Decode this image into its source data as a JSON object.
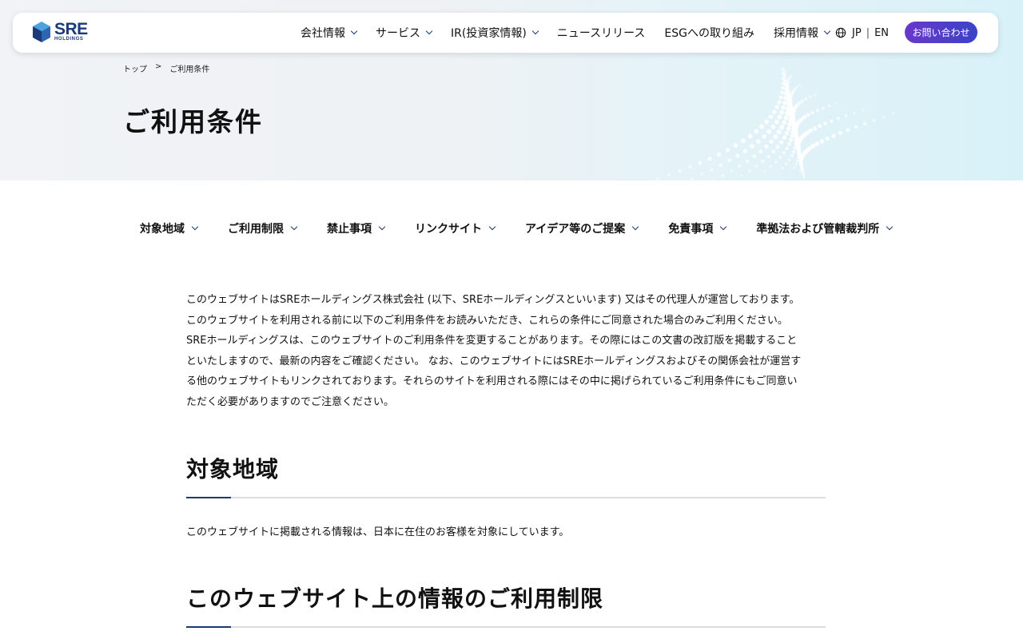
{
  "header": {
    "logo_text": "SRE",
    "logo_sub": "HOLDINGS",
    "nav": [
      {
        "label": "会社情報",
        "dropdown": true
      },
      {
        "label": "サービス",
        "dropdown": true
      },
      {
        "label": "IR(投資家情報)",
        "dropdown": true
      },
      {
        "label": "ニュースリリース",
        "dropdown": false
      },
      {
        "label": "ESGへの取り組み",
        "dropdown": false
      },
      {
        "label": "採用情報",
        "dropdown": true
      }
    ],
    "lang_jp": "JP",
    "lang_sep": "|",
    "lang_en": "EN",
    "contact_label": "お問い合わせ"
  },
  "breadcrumb": {
    "home": "トップ",
    "sep": ">",
    "current": "ご利用条件"
  },
  "page_title": "ご利用条件",
  "anchors": [
    "対象地域",
    "ご利用制限",
    "禁止事項",
    "リンクサイト",
    "アイデア等のご提案",
    "免責事項",
    "準拠法および管轄裁判所"
  ],
  "intro": [
    "このウェブサイトはSREホールディングス株式会社 (以下、SREホールディングスといいます) 又はその代理人が運営しております。",
    "このウェブサイトを利用される前に以下のご利用条件をお読みいただき、これらの条件にご同意された場合のみご利用ください。",
    "SREホールディングスは、このウェブサイトのご利用条件を変更することがあります。その際にはこの文書の改訂版を掲載すること",
    "といたしますので、最新の内容をご確認ください。 なお、このウェブサイトにはSREホールディングスおよびその関係会社が運営す",
    "る他のウェブサイトもリンクされております。それらのサイトを利用される際にはその中に掲げられているご利用条件にもご同意い",
    "ただく必要がありますのでご注意ください。"
  ],
  "sections": [
    {
      "title": "対象地域",
      "body": "このウェブサイトに掲載される情報は、日本に在住のお客様を対象にしています。"
    },
    {
      "title": "このウェブサイト上の情報のご利用制限",
      "body": ""
    }
  ],
  "colors": {
    "brand_navy": "#1a3a7a",
    "contact_gradient_start": "#6a38c9",
    "contact_gradient_end": "#3a42c9"
  }
}
